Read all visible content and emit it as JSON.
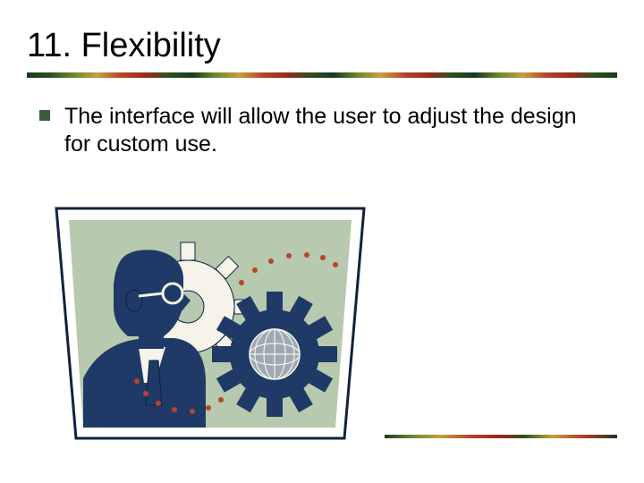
{
  "title": "11. Flexibility",
  "bullet_text": "The interface will allow the user to adjust the design for custom use."
}
